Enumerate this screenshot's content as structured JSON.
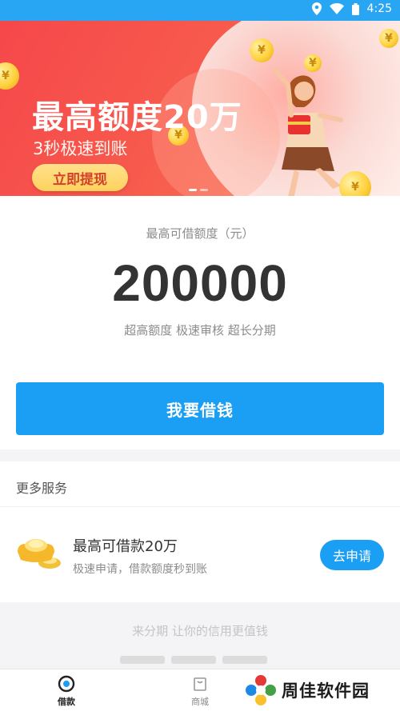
{
  "status_bar": {
    "time": "4:25"
  },
  "banner": {
    "headline": "最高额度20万",
    "subline": "3秒极速到账",
    "cta_label": "立即提现",
    "coin_symbol": "¥"
  },
  "amount_card": {
    "label": "最高可借额度（元）",
    "amount": "200000",
    "tags": "超高额度 极速审核 超长分期",
    "borrow_button": "我要借钱"
  },
  "services": {
    "title": "更多服务",
    "item": {
      "title": "最高可借款20万",
      "subtitle": "极速申请，借款额度秒到账",
      "button": "去申请"
    }
  },
  "slogan": {
    "text": "来分期 让你的信用更值钱"
  },
  "bottom_nav": {
    "items": [
      {
        "label": "借款",
        "icon": "loan-icon",
        "active": true
      },
      {
        "label": "商城",
        "icon": "shop-icon",
        "active": false
      }
    ]
  },
  "watermark": {
    "text": "周佳软件园"
  },
  "colors": {
    "primary": "#1a9ff4",
    "banner_red": "#f6474b",
    "status_bar": "#29a6f3"
  }
}
